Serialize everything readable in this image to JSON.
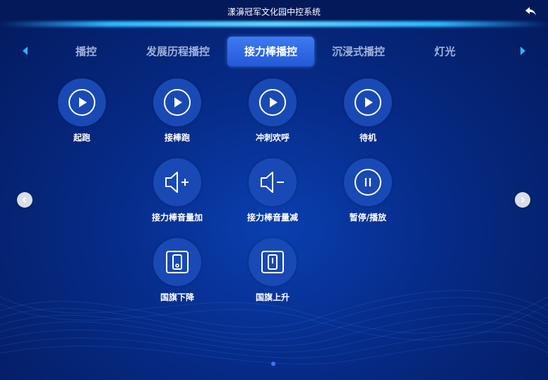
{
  "header": {
    "title": "漾濞冠军文化园中控系统",
    "back_icon": "back-arrow-icon"
  },
  "tabs": [
    {
      "label": "播控",
      "active": false
    },
    {
      "label": "发展历程播控",
      "active": false
    },
    {
      "label": "接力棒播控",
      "active": true
    },
    {
      "label": "沉浸式播控",
      "active": false
    },
    {
      "label": "灯光",
      "active": false
    }
  ],
  "controls": [
    {
      "label": "起跑",
      "icon": "play-icon"
    },
    {
      "label": "接棒跑",
      "icon": "play-icon"
    },
    {
      "label": "冲刺欢呼",
      "icon": "play-icon"
    },
    {
      "label": "待机",
      "icon": "play-icon"
    },
    {
      "label": "接力棒音量加",
      "icon": "volume-up-icon"
    },
    {
      "label": "接力棒音量减",
      "icon": "volume-down-icon"
    },
    {
      "label": "暂停/播放",
      "icon": "pause-icon"
    },
    {
      "label": "国旗下降",
      "icon": "flag-lower-icon"
    },
    {
      "label": "国旗上升",
      "icon": "flag-raise-icon"
    }
  ],
  "colors": {
    "accent": "#2bb5ff",
    "active_tab": "#2f66e0",
    "circle": "#1949b4"
  }
}
